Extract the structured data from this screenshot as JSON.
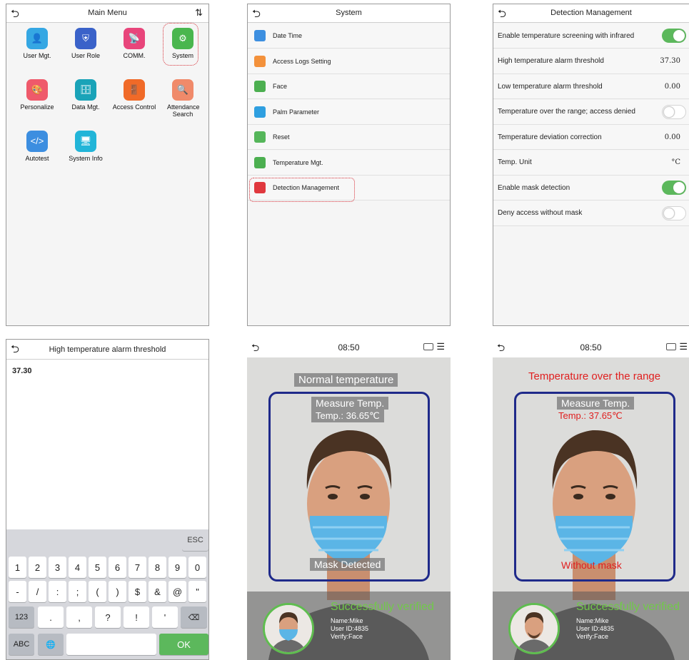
{
  "panel1": {
    "title": "Main Menu",
    "items": [
      {
        "label": "User Mgt.",
        "icon": "user-icon",
        "color": "#35a7e3"
      },
      {
        "label": "User Role",
        "icon": "shield-icon",
        "color": "#3a62c9"
      },
      {
        "label": "COMM.",
        "icon": "satellite-icon",
        "color": "#e8457b"
      },
      {
        "label": "System",
        "icon": "gear-icon",
        "color": "#4ab64e"
      },
      {
        "label": "Personalize",
        "icon": "palette-icon",
        "color": "#ef5a6b"
      },
      {
        "label": "Data Mgt.",
        "icon": "database-icon",
        "color": "#1aa3b8"
      },
      {
        "label": "Access Control",
        "icon": "door-icon",
        "color": "#f06a28"
      },
      {
        "label": "Attendance Search",
        "icon": "search-doc-icon",
        "color": "#f08a6a"
      },
      {
        "label": "Autotest",
        "icon": "code-icon",
        "color": "#3c8ee0"
      },
      {
        "label": "System Info",
        "icon": "monitor-icon",
        "color": "#22b5d8"
      }
    ]
  },
  "panel2": {
    "title": "System",
    "items": [
      {
        "label": "Date Time",
        "icon": "clock-icon",
        "color": "#3d8fe0"
      },
      {
        "label": "Access Logs Setting",
        "icon": "log-icon",
        "color": "#f3913b"
      },
      {
        "label": "Face",
        "icon": "face-icon",
        "color": "#4caf50"
      },
      {
        "label": "Palm Parameter",
        "icon": "palm-icon",
        "color": "#2f9fe0"
      },
      {
        "label": "Reset",
        "icon": "reset-icon",
        "color": "#55b65a"
      },
      {
        "label": "Temperature Mgt.",
        "icon": "thermometer-icon",
        "color": "#4caf50"
      },
      {
        "label": "Detection Management",
        "icon": "detection-icon",
        "color": "#e0383e"
      }
    ]
  },
  "panel3": {
    "title": "Detection Management",
    "rows": [
      {
        "label": "Enable temperature screening with infrared",
        "kind": "toggle",
        "on": true
      },
      {
        "label": "High temperature alarm threshold",
        "kind": "value",
        "value": "37.30"
      },
      {
        "label": "Low temperature alarm threshold",
        "kind": "value",
        "value": "0.00"
      },
      {
        "label": "Temperature over the range; access denied",
        "kind": "toggle",
        "on": false
      },
      {
        "label": "Temperature deviation correction",
        "kind": "value",
        "value": "0.00"
      },
      {
        "label": "Temp. Unit",
        "kind": "value",
        "value": "°C"
      },
      {
        "label": "Enable mask detection",
        "kind": "toggle",
        "on": true
      },
      {
        "label": "Deny access without mask",
        "kind": "toggle",
        "on": false
      }
    ]
  },
  "panel4": {
    "title": "High temperature alarm threshold",
    "input_value": "37.30",
    "esc": "ESC",
    "row1": [
      "1",
      "2",
      "3",
      "4",
      "5",
      "6",
      "7",
      "8",
      "9",
      "0"
    ],
    "row2": [
      "-",
      "/",
      ":",
      ";",
      "(",
      ")",
      "$",
      "&",
      "@",
      "\""
    ],
    "row3": [
      "123",
      ".",
      ",",
      "?",
      "!",
      "'",
      "⌫"
    ],
    "row4": [
      "ABC",
      "🌐",
      "␣",
      "OK"
    ]
  },
  "panel5": {
    "time": "08:50",
    "banner": "Normal temperature",
    "measure": "Measure Temp.",
    "temp": "Temp.: 36.65℃",
    "mask": "Mask Detected",
    "verified": "Successfully verified",
    "name": "Name:Mike",
    "userid": "User ID:4835",
    "verify": "Verify:Face"
  },
  "panel6": {
    "time": "08:50",
    "banner": "Temperature over the range",
    "measure": "Measure Temp.",
    "temp": "Temp.: 37.65℃",
    "mask": "Without mask",
    "verified": "Successfully verified",
    "name": "Name:Mike",
    "userid": "User ID:4835",
    "verify": "Verify:Face"
  },
  "colors": {
    "accent_green": "#5cb85c",
    "alert_red": "#e02020",
    "frame_blue": "#1f2a8a",
    "verified_green": "#71c949"
  }
}
